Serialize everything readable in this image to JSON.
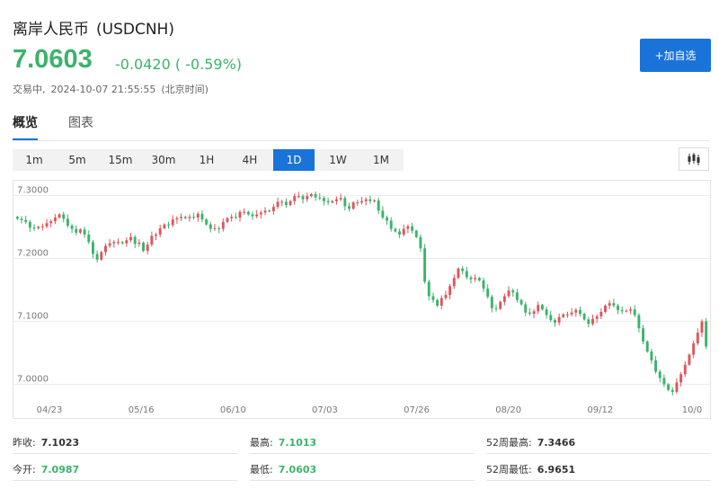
{
  "header": {
    "name": "离岸人民币",
    "symbol": "(USDCNH)",
    "price": "7.0603",
    "change": "-0.0420 ( -0.59%)",
    "status": "交易中,",
    "datetime": "2024-10-07 21:55:55",
    "timezone": "(北京时间)",
    "add_button": "+加自选"
  },
  "tabs": [
    {
      "label": "概览",
      "active": true
    },
    {
      "label": "图表",
      "active": false
    }
  ],
  "intervals": [
    {
      "label": "1m"
    },
    {
      "label": "5m"
    },
    {
      "label": "15m"
    },
    {
      "label": "30m"
    },
    {
      "label": "1H"
    },
    {
      "label": "4H"
    },
    {
      "label": "1D",
      "active": true
    },
    {
      "label": "1W"
    },
    {
      "label": "1M"
    }
  ],
  "chart_type_icon": "candlestick-icon",
  "colors": {
    "up": "#e15459",
    "down": "#3ab36b",
    "accent": "#1a73d9",
    "price": "#3ab36b"
  },
  "chart_data": {
    "type": "candlestick",
    "ylim": [
      6.975,
      7.315
    ],
    "y_ticks": [
      "7.3000",
      "7.2000",
      "7.1000",
      "7.0000"
    ],
    "y_tick_values": [
      7.3,
      7.2,
      7.1,
      7.0
    ],
    "x_ticks": [
      "04/23",
      "05/16",
      "06/10",
      "07/03",
      "07/26",
      "08/20",
      "09/12",
      "10/0"
    ],
    "grid": true,
    "closes": [
      7.263,
      7.261,
      7.258,
      7.249,
      7.248,
      7.25,
      7.251,
      7.256,
      7.259,
      7.265,
      7.27,
      7.263,
      7.252,
      7.247,
      7.241,
      7.246,
      7.238,
      7.226,
      7.207,
      7.198,
      7.21,
      7.22,
      7.224,
      7.226,
      7.226,
      7.224,
      7.229,
      7.234,
      7.223,
      7.225,
      7.212,
      7.222,
      7.236,
      7.238,
      7.248,
      7.254,
      7.253,
      7.262,
      7.264,
      7.266,
      7.264,
      7.266,
      7.265,
      7.271,
      7.262,
      7.254,
      7.247,
      7.248,
      7.247,
      7.258,
      7.264,
      7.266,
      7.265,
      7.274,
      7.274,
      7.27,
      7.267,
      7.27,
      7.273,
      7.276,
      7.275,
      7.282,
      7.29,
      7.29,
      7.285,
      7.291,
      7.299,
      7.299,
      7.294,
      7.299,
      7.302,
      7.297,
      7.296,
      7.291,
      7.289,
      7.291,
      7.294,
      7.296,
      7.283,
      7.279,
      7.289,
      7.289,
      7.291,
      7.294,
      7.291,
      7.292,
      7.276,
      7.265,
      7.26,
      7.247,
      7.243,
      7.238,
      7.247,
      7.251,
      7.244,
      7.234,
      7.216,
      7.163,
      7.14,
      7.134,
      7.125,
      7.137,
      7.142,
      7.156,
      7.169,
      7.184,
      7.18,
      7.17,
      7.167,
      7.169,
      7.165,
      7.152,
      7.139,
      7.121,
      7.12,
      7.131,
      7.14,
      7.149,
      7.146,
      7.134,
      7.127,
      7.114,
      7.112,
      7.116,
      7.126,
      7.119,
      7.11,
      7.102,
      7.098,
      7.107,
      7.111,
      7.111,
      7.114,
      7.118,
      7.112,
      7.103,
      7.096,
      7.104,
      7.108,
      7.115,
      7.125,
      7.129,
      7.125,
      7.118,
      7.116,
      7.117,
      7.119,
      7.11,
      7.089,
      7.068,
      7.052,
      7.038,
      7.02,
      7.01,
      7.0,
      6.991,
      6.988,
      7.003,
      7.016,
      7.031,
      7.047,
      7.065,
      7.082,
      7.1,
      7.06
    ]
  },
  "stats": [
    {
      "label": "昨收:",
      "value": "7.1023",
      "green": false
    },
    {
      "label": "最高:",
      "value": "7.1013",
      "green": true
    },
    {
      "label": "52周最高:",
      "value": "7.3466",
      "green": false
    },
    {
      "label": "今开:",
      "value": "7.0987",
      "green": true
    },
    {
      "label": "最低:",
      "value": "7.0603",
      "green": true
    },
    {
      "label": "52周最低:",
      "value": "6.9651",
      "green": false
    }
  ]
}
